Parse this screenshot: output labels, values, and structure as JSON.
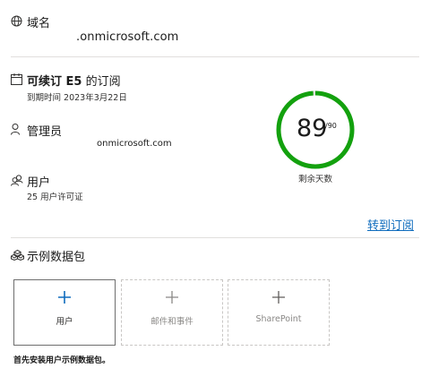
{
  "domain": {
    "label": "域名",
    "value": ".onmicrosoft.com",
    "icon": "globe-icon"
  },
  "subscription": {
    "title_strong": "可续订 E5",
    "title_rest": " 的订阅",
    "expiry": "到期时间 2023年3月22日",
    "icon": "calendar-icon"
  },
  "admin": {
    "label": "管理员",
    "value": "onmicrosoft.com",
    "icon": "person-icon"
  },
  "users": {
    "label": "用户",
    "detail": "25 用户许可证",
    "icon": "people-icon"
  },
  "days_remaining": {
    "value": "89",
    "total": "/90",
    "label": "剩余天数",
    "progress": 0.989,
    "ring_color": "#13a10e",
    "track_color": "#e1dfdd"
  },
  "goto_subscription": {
    "label": "转到订阅",
    "color": "#0f6cbd"
  },
  "sample_packs": {
    "title": "示例数据包",
    "icon": "data-pack-icon",
    "cards": [
      {
        "label": "用户",
        "state": "enabled"
      },
      {
        "label": "邮件和事件",
        "state": "disabled"
      },
      {
        "label": "SharePoint",
        "state": "disabled"
      }
    ],
    "footer": "首先安装用户示例数据包。"
  }
}
